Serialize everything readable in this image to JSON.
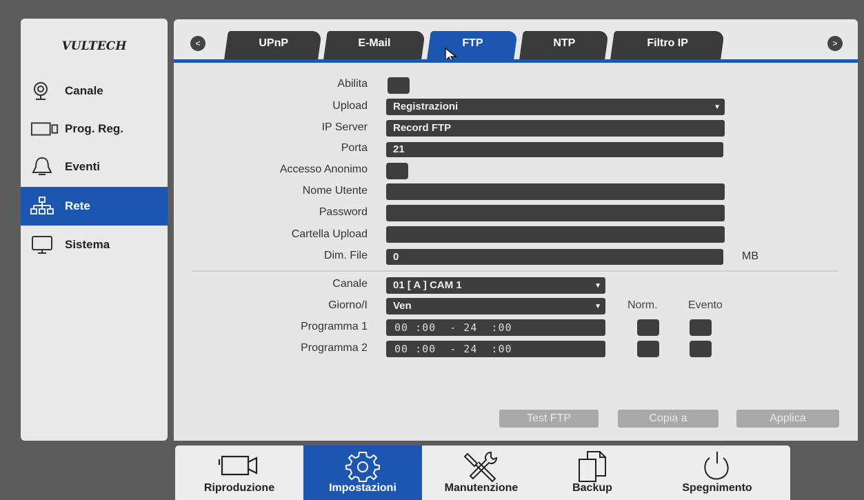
{
  "brand": {
    "logo_text": "VULTECH"
  },
  "sidebar": {
    "items": [
      {
        "label": "Canale",
        "icon": "camera-icon"
      },
      {
        "label": "Prog. Reg.",
        "icon": "recorder-icon"
      },
      {
        "label": "Eventi",
        "icon": "bell-icon"
      },
      {
        "label": "Rete",
        "icon": "network-icon",
        "active": true
      },
      {
        "label": "Sistema",
        "icon": "monitor-icon"
      }
    ]
  },
  "tabs": [
    {
      "label": "UPnP"
    },
    {
      "label": "E-Mail"
    },
    {
      "label": "FTP",
      "active": true
    },
    {
      "label": "NTP"
    },
    {
      "label": "Filtro IP"
    }
  ],
  "nav": {
    "prev": "<",
    "next": ">"
  },
  "form": {
    "enable_label": "Abilita",
    "upload_label": "Upload",
    "upload_value": "Registrazioni",
    "ip_server_label": "IP Server",
    "ip_server_value": "Record FTP",
    "port_label": "Porta",
    "port_value": "21",
    "anon_label": "Accesso Anonimo",
    "user_label": "Nome Utente",
    "user_value": "",
    "password_label": "Password",
    "password_value": "",
    "folder_label": "Cartella Upload",
    "folder_value": "",
    "filesize_label": "Dim. File",
    "filesize_value": "0",
    "filesize_unit": "MB"
  },
  "schedule": {
    "channel_label": "Canale",
    "channel_value": "01 [ A ] CAM 1",
    "day_label": "Giorno/I",
    "day_value": "Ven",
    "norm_header": "Norm.",
    "event_header": "Evento",
    "programs": [
      {
        "label": "Programma 1",
        "time": "00 :00  - 24  :00"
      },
      {
        "label": "Programma 2",
        "time": "00 :00  - 24  :00"
      }
    ]
  },
  "buttons": {
    "test": "Test FTP",
    "copy": "Copia a",
    "apply": "Applica"
  },
  "bottom_bar": [
    {
      "label": "Riproduzione",
      "icon": "video-camera-icon"
    },
    {
      "label": "Impostazioni",
      "icon": "gear-icon",
      "active": true
    },
    {
      "label": "Manutenzione",
      "icon": "tools-icon"
    },
    {
      "label": "Backup",
      "icon": "copy-files-icon"
    },
    {
      "label": "Spegnimento",
      "icon": "power-icon"
    }
  ],
  "colors": {
    "accent": "#1d56b0",
    "field": "#3e3e3e",
    "panel": "#e6e6e6"
  }
}
